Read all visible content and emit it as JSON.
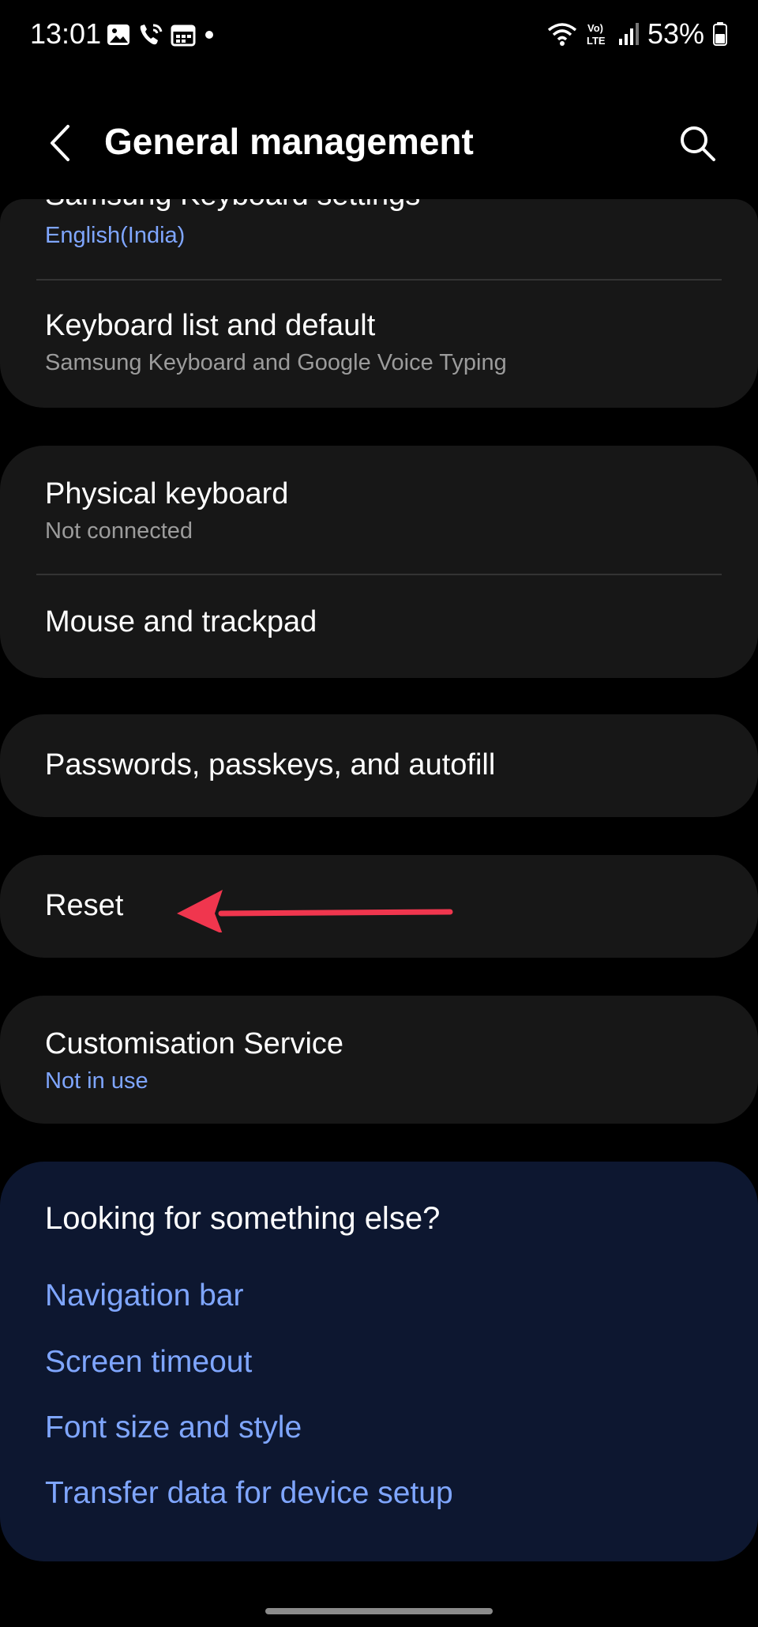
{
  "status_bar": {
    "time": "13:01",
    "battery": "53%",
    "left_icons": [
      "gallery-icon",
      "wifi-call-icon",
      "calendar-icon",
      "dot-icon"
    ],
    "right_icons": [
      "wifi-icon",
      "volte-icon",
      "signal-icon",
      "battery-icon"
    ]
  },
  "header": {
    "title": "General management"
  },
  "sections": {
    "keyboard": {
      "samsung_keyboard": {
        "title": "Samsung Keyboard settings",
        "subtitle": "English(India)"
      },
      "keyboard_list": {
        "title": "Keyboard list and default",
        "subtitle": "Samsung Keyboard and Google Voice Typing"
      }
    },
    "input_devices": {
      "physical_keyboard": {
        "title": "Physical keyboard",
        "subtitle": "Not connected"
      },
      "mouse": {
        "title": "Mouse and trackpad"
      }
    },
    "passwords": {
      "title": "Passwords, passkeys, and autofill"
    },
    "reset": {
      "title": "Reset"
    },
    "customisation": {
      "title": "Customisation Service",
      "subtitle": "Not in use"
    }
  },
  "looking_for": {
    "title": "Looking for something else?",
    "links": [
      "Navigation bar",
      "Screen timeout",
      "Font size and style",
      "Transfer data for device setup"
    ]
  },
  "colors": {
    "background": "#000000",
    "card": "#171717",
    "accent": "#7fa6ff",
    "looking_bg": "#0d1730",
    "arrow": "#f0364e"
  }
}
